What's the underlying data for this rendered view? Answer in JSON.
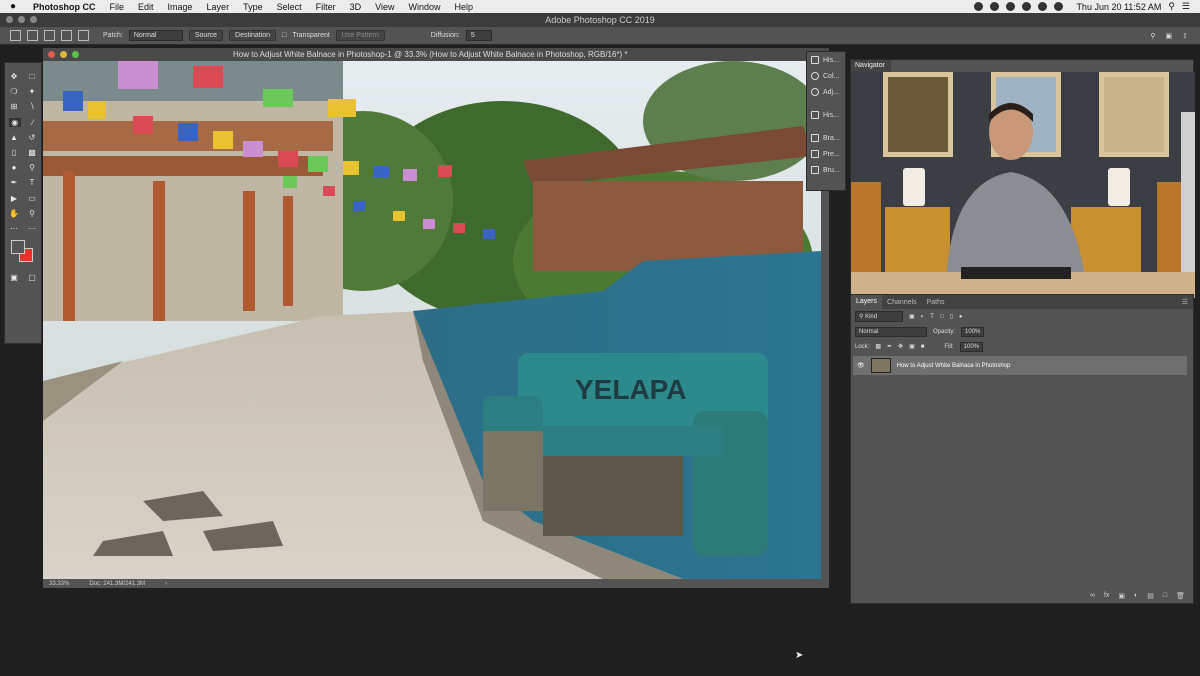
{
  "menubar": {
    "apple": "",
    "app_name": "Photoshop CC",
    "items": [
      "File",
      "Edit",
      "Image",
      "Layer",
      "Type",
      "Select",
      "Filter",
      "3D",
      "View",
      "Window",
      "Help"
    ],
    "clock": "Thu Jun 20  11:52 AM"
  },
  "app_title": "Adobe Photoshop CC 2019",
  "options_bar": {
    "patch_label": "Patch:",
    "patch_value": "Normal",
    "source_label": "Source",
    "destination_label": "Destination",
    "transparent_label": "Transparent",
    "use_pattern_label": "Use Pattern",
    "diffusion_label": "Diffusion:",
    "diffusion_value": "5"
  },
  "document": {
    "title": "How to Adjust White Balnace in Photoshop-1 @ 33.3% (How to Adjust White Balnace in Photoshop, RGB/16*) *",
    "zoom": "33.33%",
    "doc_size": "Doc: 241.3M/241.3M",
    "sign_text": "YELAPA"
  },
  "panel_dock": {
    "items": [
      "His...",
      "Col...",
      "Adj...",
      "His...",
      "Bra...",
      "Pre...",
      "Bru..."
    ]
  },
  "navigator": {
    "tab_label": "Navigator"
  },
  "layers_panel": {
    "tabs": [
      "Layers",
      "Channels",
      "Paths"
    ],
    "kind_label": "Kind",
    "blend_mode": "Normal",
    "opacity_label": "Opacity:",
    "opacity_value": "100%",
    "lock_label": "Lock:",
    "fill_label": "Fill:",
    "fill_value": "100%",
    "layer_name": "How to Adjust White Balnace in Photoshop"
  },
  "colors": {
    "foreground": "#555555",
    "background": "#e8322a",
    "canvas_wall": "#2f7d95"
  }
}
